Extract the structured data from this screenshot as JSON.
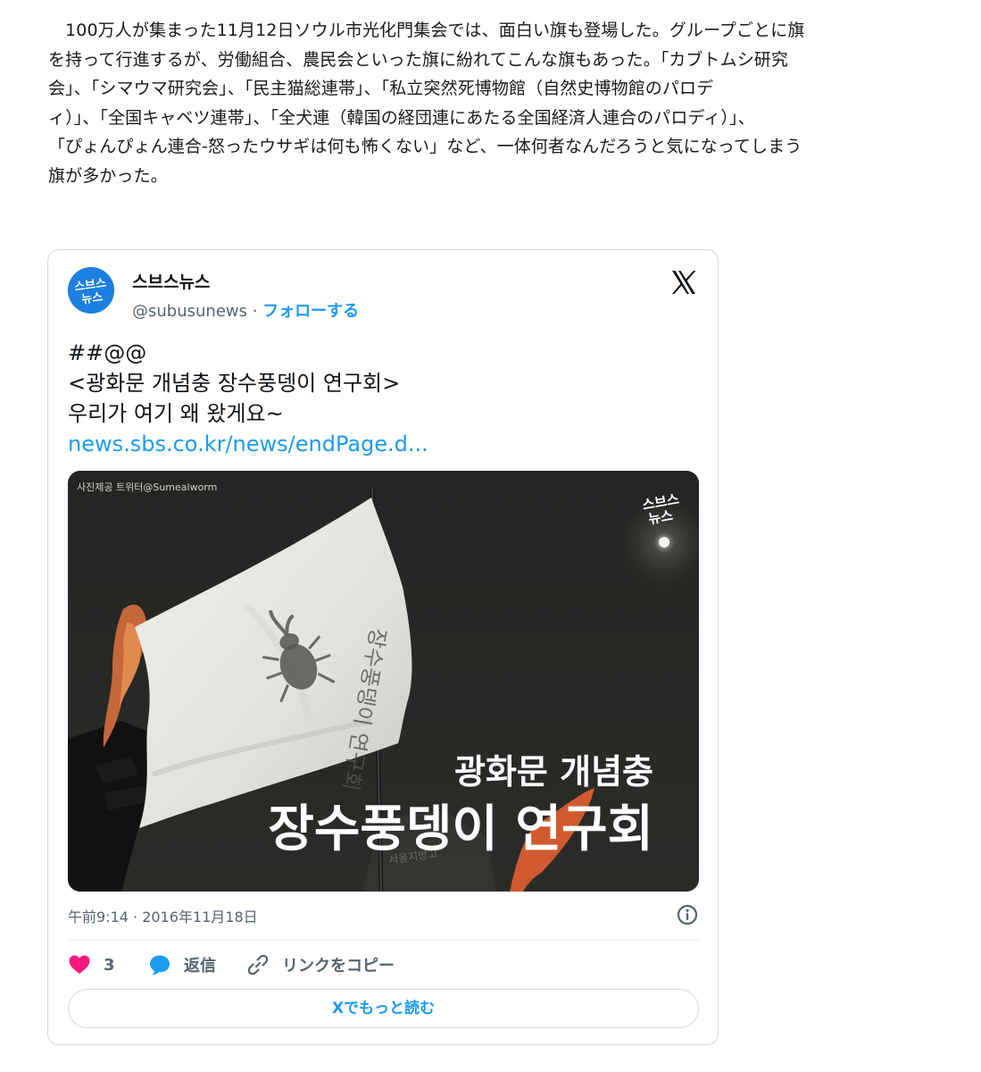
{
  "article": {
    "lines": [
      "　100万人が集まった11月12日ソウル市光化門集会では、面白い旗も登場した。グループごとに旗",
      "を持って行進するが、労働組合、農民会といった旗に紛れてこんな旗もあった。「カブトムシ研究",
      "会」、「シマウマ研究会」、「民主猫総連帯」、「私立突然死博物館（自然史博物館のパロデ",
      "ィ）」、「全国キャベツ連帯」、「全犬連（韓国の経団連にあたる全国経済人連合のパロディ）」、",
      "「ぴょんぴょん連合-怒ったウサギは何も怖くない」など、一体何者なんだろうと気になってしまう",
      "旗が多かった。"
    ]
  },
  "tweet": {
    "author_name": "스브스뉴스",
    "handle": "@subusunews",
    "separator": " · ",
    "follow_label": "フォローする",
    "avatar_text": [
      "스브스",
      "뉴스"
    ],
    "avatar_color": "#1d7fe0",
    "text_lines": [
      "##@@",
      "<광화문 개념충 장수풍뎅이 연구회>",
      "우리가 여기 왜 왔게요~"
    ],
    "link_text": "news.sbs.co.kr/news/endPage.d...",
    "image": {
      "credit": "사진제공 트위터@Sumealworm",
      "logo_top": "스브스",
      "logo_bottom": "뉴스",
      "caption_line1": "광화문 개념충",
      "caption_line2": "장수풍뎅이 연구회",
      "flag_text": "장수풍뎅이 연구회"
    },
    "timestamp": "午前9:14 · 2016年11月18日",
    "like_count": "3",
    "reply_label": "返信",
    "copy_link_label": "リンクをコピー",
    "read_more_label": "Xでもっと読む",
    "icons": {
      "like": "heart-icon",
      "reply": "speech-bubble-icon",
      "copy": "link-icon",
      "info": "info-icon",
      "brand": "x-logo-icon"
    },
    "colors": {
      "like": "#f91880",
      "reply": "#1d9bf0",
      "link": "#1d9bf0",
      "muted": "#536471"
    }
  }
}
